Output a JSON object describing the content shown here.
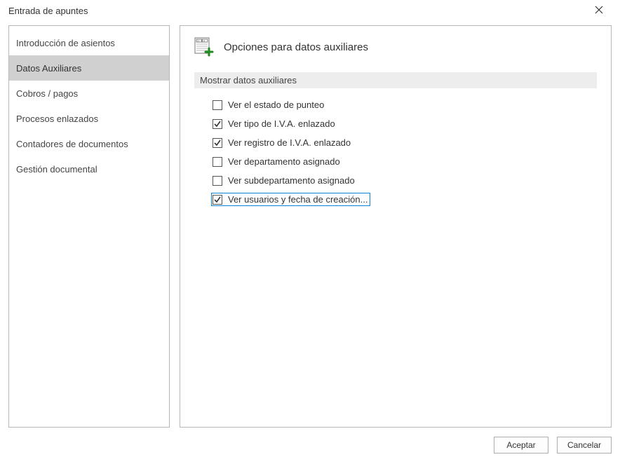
{
  "window": {
    "title": "Entrada de apuntes"
  },
  "sidebar": {
    "items": [
      {
        "label": "Introducción de asientos",
        "selected": false
      },
      {
        "label": "Datos Auxiliares",
        "selected": true
      },
      {
        "label": "Cobros / pagos",
        "selected": false
      },
      {
        "label": "Procesos enlazados",
        "selected": false
      },
      {
        "label": "Contadores de documentos",
        "selected": false
      },
      {
        "label": "Gestión documental",
        "selected": false
      }
    ]
  },
  "main": {
    "title": "Opciones para datos auxiliares",
    "section_label": "Mostrar datos auxiliares",
    "options": [
      {
        "label": "Ver el estado de punteo",
        "checked": false,
        "focused": false
      },
      {
        "label": "Ver tipo de I.V.A. enlazado",
        "checked": true,
        "focused": false
      },
      {
        "label": "Ver registro de I.V.A. enlazado",
        "checked": true,
        "focused": false
      },
      {
        "label": "Ver departamento asignado",
        "checked": false,
        "focused": false
      },
      {
        "label": "Ver subdepartamento asignado",
        "checked": false,
        "focused": false
      },
      {
        "label": "Ver usuarios y fecha de creación...",
        "checked": true,
        "focused": true
      }
    ]
  },
  "footer": {
    "accept": "Aceptar",
    "cancel": "Cancelar"
  }
}
